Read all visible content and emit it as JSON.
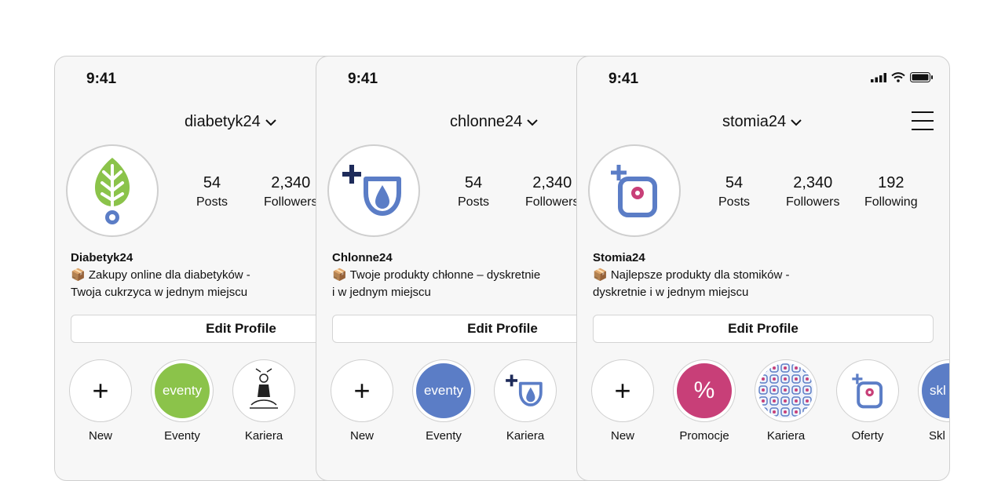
{
  "colors": {
    "green": "#8bc34a",
    "blue": "#5b7dc6",
    "navy": "#1e2b5a",
    "pink": "#c83f78"
  },
  "phones": [
    {
      "time": "9:41",
      "username": "diabetyk24",
      "stats": [
        {
          "value": "54",
          "label": "Posts"
        },
        {
          "value": "2,340",
          "label": "Followers"
        }
      ],
      "name": "Diabetyk24",
      "bio": [
        "📦 Zakupy online dla diabetyków -",
        "Twoja cukrzyca w jednym miejscu"
      ],
      "edit_label": "Edit Profile",
      "highlights": [
        {
          "label": "New",
          "icon": "plus-icon"
        },
        {
          "label": "Eventy",
          "cover": "eventy"
        },
        {
          "label": "Kariera",
          "icon": "yoga-figure-icon"
        }
      ]
    },
    {
      "time": "9:41",
      "username": "chlonne24",
      "stats": [
        {
          "value": "54",
          "label": "Posts"
        },
        {
          "value": "2,340",
          "label": "Followers"
        }
      ],
      "name": "Chlonne24",
      "bio": [
        "📦 Twoje produkty chłonne – dyskretnie",
        "i w jednym miejscu"
      ],
      "edit_label": "Edit Profile",
      "highlights": [
        {
          "label": "New",
          "icon": "plus-icon"
        },
        {
          "label": "Eventy",
          "cover": "eventy"
        },
        {
          "label": "Kariera",
          "icon": "chlonne-logo-icon"
        }
      ]
    },
    {
      "time": "9:41",
      "username": "stomia24",
      "stats": [
        {
          "value": "54",
          "label": "Posts"
        },
        {
          "value": "2,340",
          "label": "Followers"
        },
        {
          "value": "192",
          "label": "Following"
        }
      ],
      "name": "Stomia24",
      "bio": [
        "📦 Najlepsze produkty dla stomików -",
        "dyskretnie i w jednym miejscu"
      ],
      "edit_label": "Edit Profile",
      "highlights": [
        {
          "label": "New",
          "icon": "plus-icon"
        },
        {
          "label": "Promocje",
          "cover": "%"
        },
        {
          "label": "Kariera",
          "icon": "pattern-icon"
        },
        {
          "label": "Oferty",
          "icon": "stomia-logo-icon"
        },
        {
          "label": "Skl",
          "cover": "skl"
        }
      ]
    }
  ]
}
